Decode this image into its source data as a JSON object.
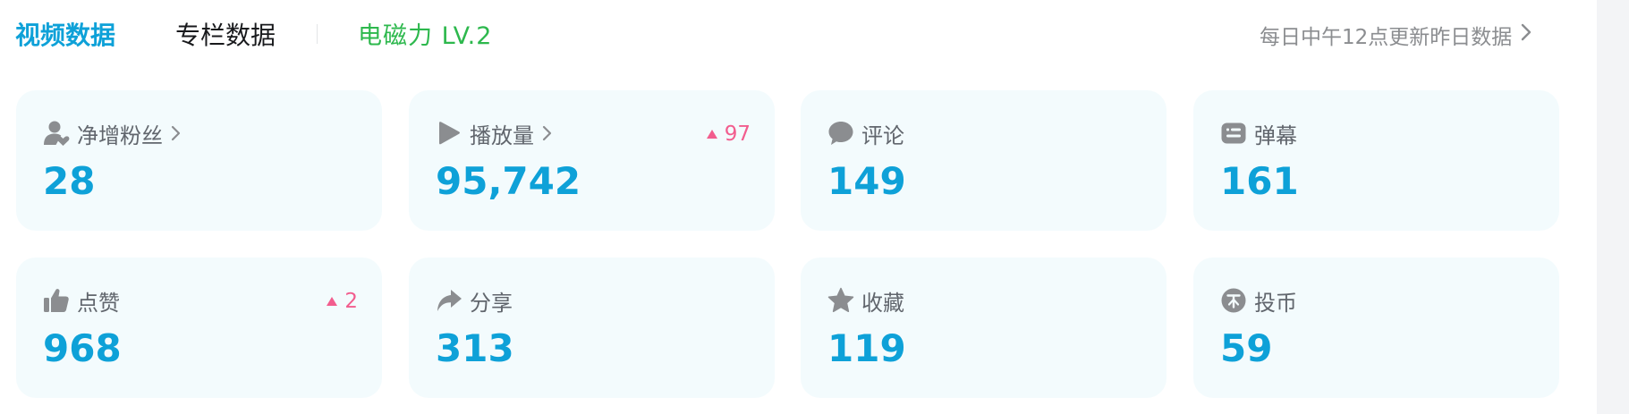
{
  "tabs": {
    "video": "视频数据",
    "article": "专栏数据"
  },
  "level_badge": "电磁力 LV.2",
  "update_note": "每日中午12点更新昨日数据",
  "cards": [
    {
      "label": "净增粉丝",
      "value": "28",
      "delta": "",
      "icon": "user-heart-icon"
    },
    {
      "label": "播放量",
      "value": "95,742",
      "delta": "97",
      "icon": "play-icon"
    },
    {
      "label": "评论",
      "value": "149",
      "delta": "",
      "icon": "comment-icon"
    },
    {
      "label": "弹幕",
      "value": "161",
      "delta": "",
      "icon": "danmaku-icon"
    },
    {
      "label": "点赞",
      "value": "968",
      "delta": "2",
      "icon": "thumbs-up-icon"
    },
    {
      "label": "分享",
      "value": "313",
      "delta": "",
      "icon": "share-icon"
    },
    {
      "label": "收藏",
      "value": "119",
      "delta": "",
      "icon": "star-icon"
    },
    {
      "label": "投币",
      "value": "59",
      "delta": "",
      "icon": "coin-icon"
    }
  ],
  "colors": {
    "accent": "#0ea1d8",
    "level": "#2db84d",
    "increase": "#f25d8e",
    "card_bg": "#f3fbfd",
    "label": "#61666d",
    "icon": "#8b8d90"
  }
}
